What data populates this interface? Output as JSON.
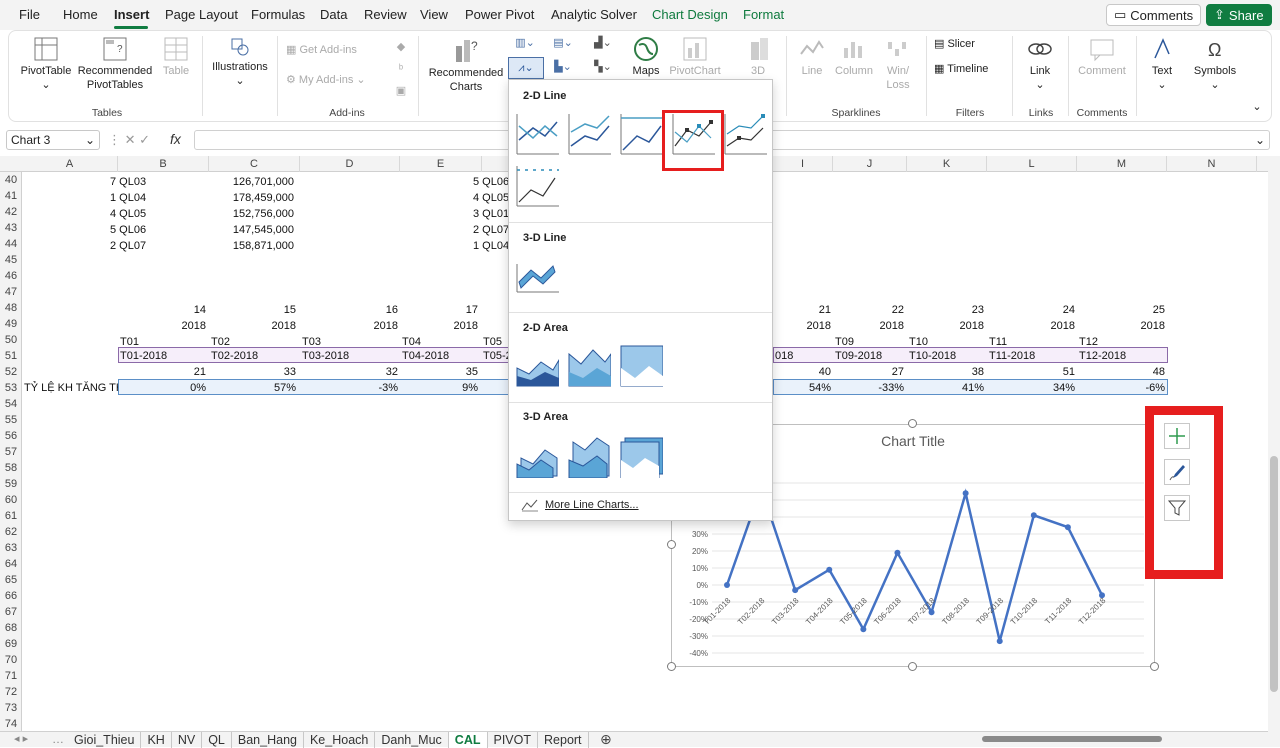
{
  "menu": {
    "items": [
      "File",
      "Home",
      "Insert",
      "Page Layout",
      "Formulas",
      "Data",
      "Review",
      "View",
      "Power Pivot",
      "Analytic Solver"
    ],
    "context_items": [
      "Chart Design",
      "Format"
    ],
    "comments": "Comments",
    "share": "Share"
  },
  "ribbon": {
    "pivottable": "PivotTable",
    "recommended_pivottables_1": "Recommended",
    "recommended_pivottables_2": "PivotTables",
    "table": "Table",
    "illustrations": "Illustrations",
    "get_addins": "Get Add-ins",
    "my_addins": "My Add-ins",
    "recommended_charts_1": "Recommended",
    "recommended_charts_2": "Charts",
    "maps": "Maps",
    "pivotchart": "PivotChart",
    "threed_1": "3D",
    "line": "Line",
    "column": "Column",
    "winloss_1": "Win/",
    "winloss_2": "Loss",
    "slicer": "Slicer",
    "timeline": "Timeline",
    "link": "Link",
    "comment": "Comment",
    "text": "Text",
    "symbols": "Symbols",
    "groups": {
      "tables": "Tables",
      "addins": "Add-ins",
      "sparklines": "Sparklines",
      "filters": "Filters",
      "links": "Links",
      "comments": "Comments"
    }
  },
  "formula_bar": {
    "name_box": "Chart 3",
    "fx": "fx"
  },
  "columns": [
    "A",
    "B",
    "C",
    "D",
    "E",
    "I",
    "J",
    "K",
    "L",
    "M",
    "N"
  ],
  "rows": [
    "40",
    "41",
    "42",
    "43",
    "44",
    "45",
    "46",
    "47",
    "48",
    "49",
    "50",
    "51",
    "52",
    "53",
    "54",
    "55",
    "56",
    "57",
    "58",
    "59",
    "60",
    "61",
    "62",
    "63",
    "64",
    "65",
    "66",
    "67",
    "68",
    "69",
    "70",
    "71",
    "72",
    "73",
    "74"
  ],
  "sheet": {
    "b_col": [
      "7 QL03",
      "1 QL04",
      "4 QL05",
      "5 QL06",
      "2 QL07"
    ],
    "c_col": [
      "126,701,000",
      "178,459,000",
      "152,756,000",
      "147,545,000",
      "158,871,000"
    ],
    "e_col": [
      "5 QL06",
      "4 QL05",
      "3 QL01",
      "2 QL07",
      "1 QL04"
    ],
    "row48": [
      "14",
      "15",
      "16",
      "17",
      "21",
      "22",
      "23",
      "24",
      "25"
    ],
    "year": "2018",
    "row50": [
      "T01",
      "T02",
      "T03",
      "T04",
      "T05",
      "T09",
      "T10",
      "T11",
      "T12"
    ],
    "row51": [
      "T01-2018",
      "T02-2018",
      "T03-2018",
      "T04-2018",
      "T05-2",
      "T08-2018",
      "T09-2018",
      "T10-2018",
      "T11-2018",
      "T12-2018"
    ],
    "row51_tail": "018",
    "row52": [
      "21",
      "33",
      "32",
      "35",
      "40",
      "27",
      "38",
      "51",
      "48"
    ],
    "row53_label": "TỶ LỆ KH TĂNG THÊ",
    "row53": [
      "0%",
      "57%",
      "-3%",
      "9%",
      "54%",
      "-33%",
      "41%",
      "34%",
      "-6%"
    ]
  },
  "dropdown": {
    "section_2d_line": "2-D Line",
    "section_3d_line": "3-D Line",
    "section_2d_area": "2-D Area",
    "section_3d_area": "3-D Area",
    "more": "More Line Charts..."
  },
  "chart_data": {
    "type": "line",
    "title": "Chart Title",
    "categories": [
      "T01-2018",
      "T02-2018",
      "T03-2018",
      "T04-2018",
      "T05-2018",
      "T06-2018",
      "T07-2018",
      "T08-2018",
      "T09-2018",
      "T10-2018",
      "T11-2018",
      "T12-2018"
    ],
    "series": [
      {
        "values": [
          0,
          57,
          -3,
          9,
          -26,
          19,
          -16,
          54,
          -33,
          41,
          34,
          -6
        ]
      }
    ],
    "y_tick_labels": [
      "30%",
      "20%",
      "10%",
      "0%",
      "-10%",
      "-20%",
      "-30%",
      "-40%"
    ],
    "ylim": [
      -40,
      60
    ],
    "grid": true,
    "color": "#4472c4"
  },
  "tabs": [
    "Gioi_Thieu",
    "KH",
    "NV",
    "QL",
    "Ban_Hang",
    "Ke_Hoach",
    "Danh_Muc",
    "CAL",
    "PIVOT",
    "Report"
  ],
  "active_tab": "CAL"
}
